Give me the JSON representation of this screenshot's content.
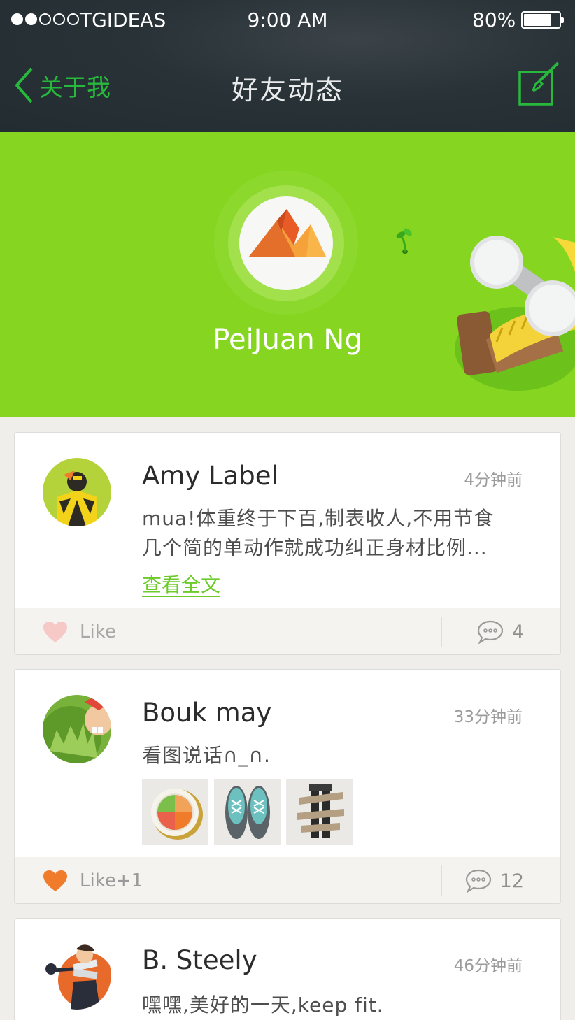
{
  "status_bar": {
    "carrier": "TGIDEAS",
    "time": "9:00 AM",
    "battery": "80%",
    "battery_level": 0.8,
    "signal_bars_filled": 2,
    "signal_bars_total": 5
  },
  "nav": {
    "back_label": "关于我",
    "title": "好友动态",
    "back_icon": "chevron-left-icon",
    "edit_icon": "compose-icon"
  },
  "profile": {
    "name": "PeiJuan Ng"
  },
  "colors": {
    "accent_green": "#86d621",
    "nav_green": "#27b93c",
    "liked_orange": "#f07b2a",
    "unliked_pink": "#f6c9c6"
  },
  "posts": [
    {
      "name": "Amy Label",
      "time": "4分钟前",
      "text_lines": [
        "mua!体重终于下百,制表收人,不用节食",
        "几个简的单动作就成功纠正身材比例..."
      ],
      "more_label": "查看全文",
      "like_label": "Like",
      "liked": false,
      "comment_count": "4"
    },
    {
      "name": "Bouk may",
      "time": "33分钟前",
      "text_lines": [
        "看图说话∩_∩."
      ],
      "images": [
        "plate-image",
        "sneakers-image",
        "measured-legs-image"
      ],
      "like_label": "Like+1",
      "liked": true,
      "comment_count": "12"
    },
    {
      "name": "B. Steely",
      "time": "46分钟前",
      "text_lines": [
        "嘿嘿,美好的一天,keep fit."
      ]
    }
  ]
}
